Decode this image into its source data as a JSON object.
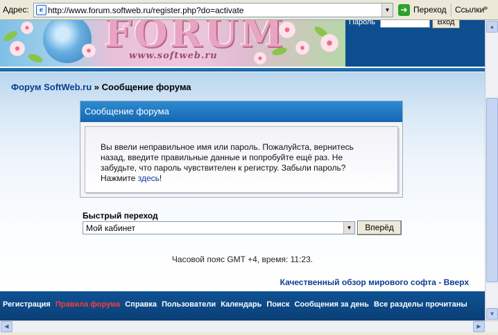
{
  "address_bar": {
    "label": "Адрес:",
    "url": "http://www.forum.softweb.ru/register.php?do=activate",
    "go_label": "Переход",
    "links_label": "Ссылки"
  },
  "header": {
    "logo_title": "FORUM",
    "logo_subtitle": "www.softweb.ru",
    "password_label": "Пароль",
    "login_button": "Вход"
  },
  "breadcrumb": {
    "link": "Форум SoftWeb.ru",
    "separator": " » ",
    "current": "Сообщение форума"
  },
  "message": {
    "title": "Сообщение форума",
    "text": "Вы ввели неправильное имя или пароль. Пожалуйста, вернитесь назад, введите правильные данные и попробуйте ещё раз. Не забудьте, что пароль чувствителен к регистру. Забыли пароль? Нажмите ",
    "link": "здесь",
    "tail": "!"
  },
  "quick_jump": {
    "label": "Быстрый переход",
    "selected": "Мой кабинет",
    "button": "Вперёд"
  },
  "timezone": "Часовой пояс GMT +4, время: 11:23.",
  "footer_link": "Качественный обзор мирового софта - Вверх",
  "bottom_nav": {
    "items": [
      "Регистрация",
      "Правила форума",
      "Справка",
      "Пользователи",
      "Календарь",
      "Поиск",
      "Сообщения за день",
      "Все разделы прочитаны"
    ]
  },
  "colors": {
    "header_blue": "#0d4f8e",
    "panel_header": "#1567b0",
    "link": "#0b3d91",
    "rules_red": "#ff3a3a"
  }
}
